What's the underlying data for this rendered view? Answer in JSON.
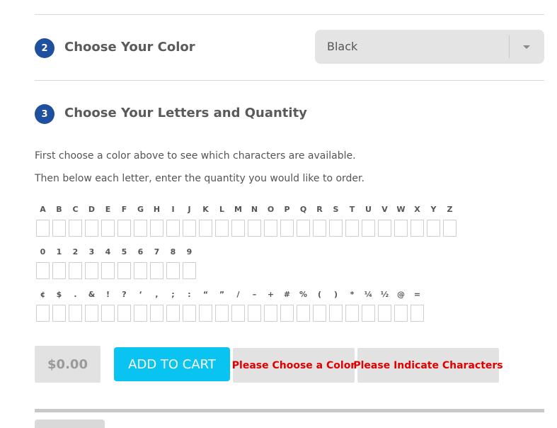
{
  "step2": {
    "number": "2",
    "title": "Choose Your Color"
  },
  "color_select": {
    "value": "Black",
    "caret_icon": "chevron-down-icon"
  },
  "step3": {
    "number": "3",
    "title": "Choose Your Letters and Quantity"
  },
  "instructions": {
    "line1": "First choose a color above to see which characters are available.",
    "line2": "Then below each letter, enter the quantity you would like to order."
  },
  "letters": [
    "A",
    "B",
    "C",
    "D",
    "E",
    "F",
    "G",
    "H",
    "I",
    "J",
    "K",
    "L",
    "M",
    "N",
    "O",
    "P",
    "Q",
    "R",
    "S",
    "T",
    "U",
    "V",
    "W",
    "X",
    "Y",
    "Z"
  ],
  "digits": [
    "0",
    "1",
    "2",
    "3",
    "4",
    "5",
    "6",
    "7",
    "8",
    "9"
  ],
  "symbols": [
    "¢",
    "$",
    ".",
    "&",
    "!",
    "?",
    "‘",
    ",",
    ";",
    ":",
    "“",
    "”",
    "/",
    "–",
    "+",
    "#",
    "%",
    "(",
    ")",
    "*",
    "¼",
    "½",
    "@",
    "="
  ],
  "price": "$0.00",
  "add_to_cart_label": "ADD TO CART",
  "warnings": {
    "color": "Please Choose a Color",
    "characters": "Please Indicate Characters"
  },
  "colors": {
    "accent": "#09c3f1",
    "step": "#1f4f9f",
    "warning": "#e00000"
  }
}
